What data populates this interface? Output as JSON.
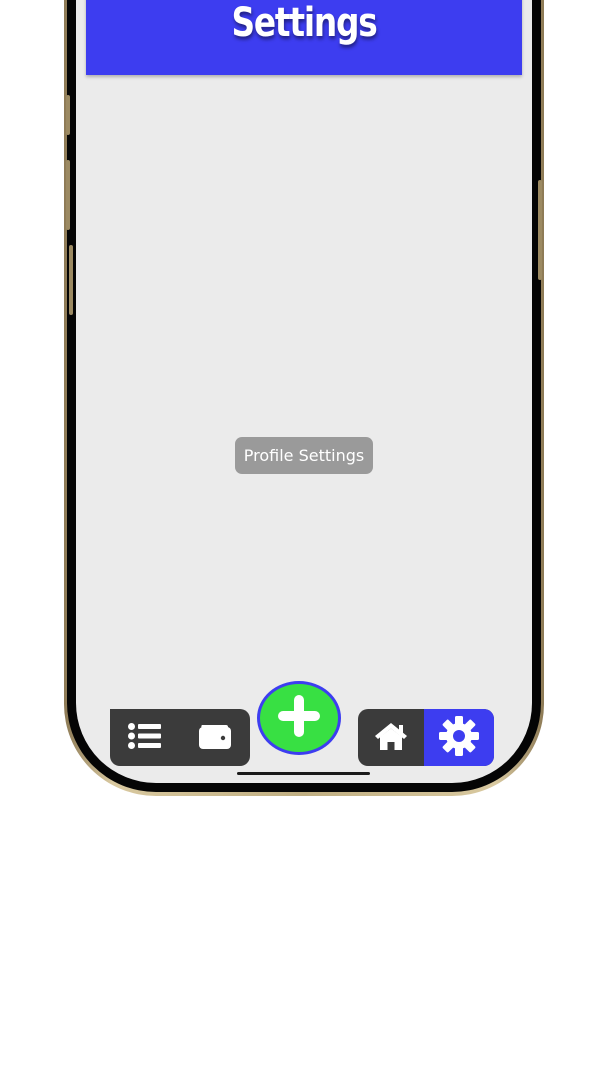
{
  "header": {
    "title": "Settings"
  },
  "main": {
    "profile_button_label": "Profile Settings"
  },
  "bottom_nav": {
    "items": [
      {
        "name": "list",
        "icon": "list-icon",
        "active": false
      },
      {
        "name": "wallet",
        "icon": "wallet-icon",
        "active": false
      },
      {
        "name": "add",
        "icon": "plus-icon",
        "active": false
      },
      {
        "name": "home",
        "icon": "home-icon",
        "active": false
      },
      {
        "name": "settings",
        "icon": "gear-icon",
        "active": true
      }
    ]
  },
  "colors": {
    "accent": "#3d3df0",
    "fab": "#38e043",
    "nav_background": "#3b3b3b",
    "screen_background": "#ebebeb",
    "profile_button": "#9a9a9a"
  }
}
